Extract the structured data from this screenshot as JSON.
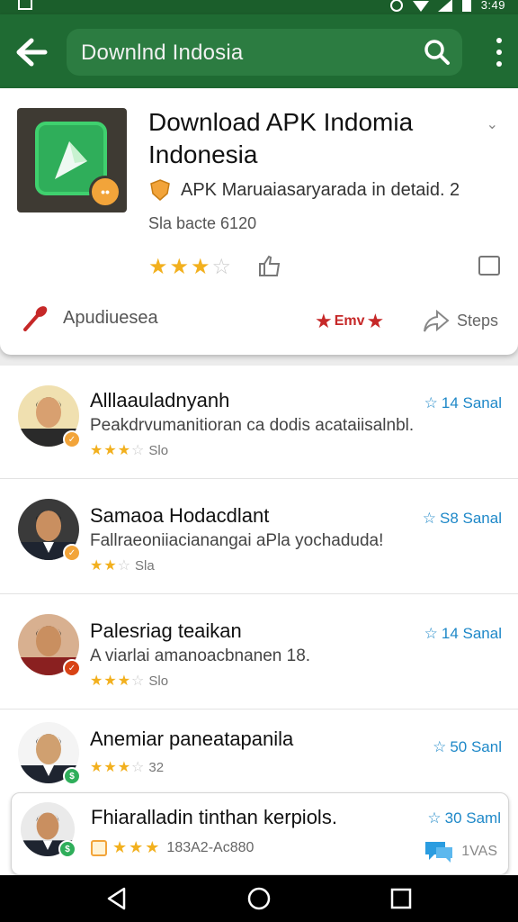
{
  "status_bar": {
    "time": "3:49"
  },
  "search": {
    "query": "Downlnd Indosia"
  },
  "app": {
    "title": "Download APK Indomia Indonesia",
    "subtitle": "APK  Maruaiasaryarada in detaid. 2",
    "size": "Sla bacte 6120",
    "badge_text": "••",
    "rating": {
      "filled": 3,
      "total": 5
    },
    "action_label": "Apudiuesea",
    "favorite_label": "Emv",
    "steps_label": "Steps"
  },
  "reviews": [
    {
      "name": "Alllaauladnyanh",
      "text": "Peakdrvumanitioran ca dodis acataiisalnbl.",
      "meta": "14 Sanal",
      "rating": 3,
      "count": "Slo",
      "badge_color": "#f2a43a",
      "skin": "#d8a070",
      "bg": "#f0e0b0"
    },
    {
      "name": "Samaoa Hodacdlant",
      "text": "Fallraeoniiacianangai aPla yochaduda!",
      "meta": "S8 Sanal",
      "rating": 2,
      "count": "Sla",
      "badge_color": "#f2a43a",
      "skin": "#c98f60",
      "bg": "#3a3a3a"
    },
    {
      "name": "Palesriag teaikan",
      "text": "A viarlai amanoacbnanen  18.",
      "meta": "14 Sanal",
      "rating": 3,
      "count": "Slo",
      "badge_color": "#d84315",
      "skin": "#c98f60",
      "bg": "#d8b090"
    },
    {
      "name": "Anemiar paneatapanila",
      "text": "",
      "meta": "50 Sanl",
      "rating": 3,
      "count": "32",
      "badge_color": "#2fae5a",
      "skin": "#d0a070",
      "bg": "#f4f4f4"
    }
  ],
  "last_review": {
    "name": "Fhiaralladin tinthan kerpiols.",
    "meta": "30 Saml",
    "rating": 3,
    "count": "183A2-Ac880",
    "chat_label": "1VAS"
  }
}
